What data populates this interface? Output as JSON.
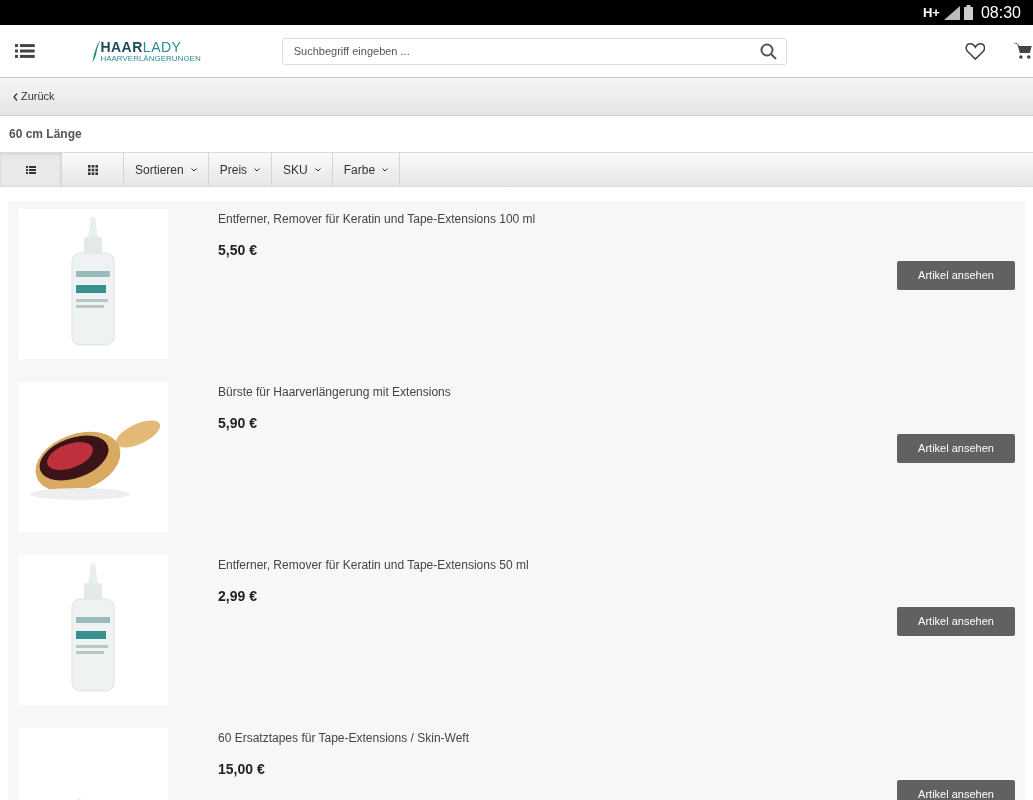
{
  "status_bar": {
    "network": "H+",
    "time": "08:30"
  },
  "header": {
    "logo": {
      "strong": "HAAR",
      "light": "LADY",
      "tagline": "HAARVERLÄNGERUNGEN"
    },
    "search": {
      "placeholder": "Suchbegriff eingeben ..."
    }
  },
  "back_link": "Zurück",
  "category_title": "60 cm Länge",
  "view_modes": [
    {
      "kind": "list",
      "selected": true
    },
    {
      "kind": "grid",
      "selected": false
    }
  ],
  "filters": [
    "Sortieren",
    "Preis",
    "SKU",
    "Farbe"
  ],
  "products": [
    {
      "name": "Entferner, Remover für Keratin und Tape-Extensions 100 ml",
      "price": "5,50 €",
      "button": "Artikel ansehen"
    },
    {
      "name": "Bürste für Haarverlängerung mit Extensions",
      "price": "5,90 €",
      "button": "Artikel ansehen"
    },
    {
      "name": "Entferner, Remover für Keratin und Tape-Extensions 50 ml",
      "price": "2,99 €",
      "button": "Artikel ansehen"
    },
    {
      "name": "60 Ersatztapes für Tape-Extensions / Skin-Weft",
      "price": "15,00 €",
      "button": "Artikel ansehen"
    }
  ]
}
